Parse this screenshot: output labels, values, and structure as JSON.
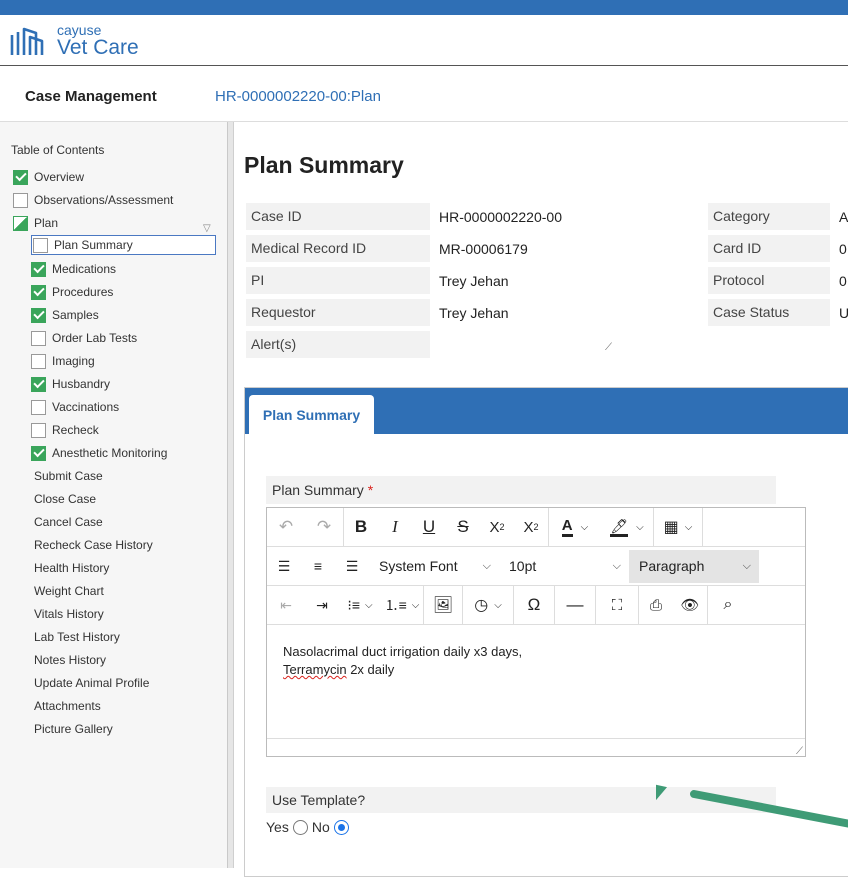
{
  "brand": {
    "small": "cayuse",
    "big": "Vet Care"
  },
  "header": {
    "title": "Case Management",
    "case": "HR-0000002220-00:Plan"
  },
  "toc": {
    "title": "Table of Contents",
    "items": [
      {
        "label": "Overview",
        "state": "checked"
      },
      {
        "label": "Observations/Assessment",
        "state": "empty"
      },
      {
        "label": "Plan",
        "state": "half"
      },
      {
        "label": "Plan Summary",
        "state": "empty",
        "selected": true
      },
      {
        "label": "Medications",
        "state": "checked"
      },
      {
        "label": "Procedures",
        "state": "checked"
      },
      {
        "label": "Samples",
        "state": "checked"
      },
      {
        "label": "Order Lab Tests",
        "state": "empty"
      },
      {
        "label": "Imaging",
        "state": "empty"
      },
      {
        "label": "Husbandry",
        "state": "checked"
      },
      {
        "label": "Vaccinations",
        "state": "empty"
      },
      {
        "label": "Recheck",
        "state": "empty"
      },
      {
        "label": "Anesthetic Monitoring",
        "state": "checked"
      },
      {
        "label": "Submit Case"
      },
      {
        "label": "Close Case"
      },
      {
        "label": "Cancel Case"
      },
      {
        "label": "Recheck Case History"
      },
      {
        "label": "Health History"
      },
      {
        "label": "Weight Chart"
      },
      {
        "label": "Vitals History"
      },
      {
        "label": "Lab Test History"
      },
      {
        "label": "Notes History"
      },
      {
        "label": "Update Animal Profile"
      },
      {
        "label": "Attachments"
      },
      {
        "label": "Picture Gallery"
      }
    ]
  },
  "page_title": "Plan Summary",
  "fields": {
    "case_id": {
      "label": "Case ID",
      "value": "HR-0000002220-00"
    },
    "medical_record_id": {
      "label": "Medical Record ID",
      "value": "MR-00006179"
    },
    "pi": {
      "label": "PI",
      "value": "Trey Jehan"
    },
    "requestor": {
      "label": "Requestor",
      "value": "Trey Jehan"
    },
    "alerts": {
      "label": "Alert(s)",
      "value": ""
    },
    "category": {
      "label": "Category",
      "value": "A"
    },
    "card_id": {
      "label": "Card ID",
      "value": "0"
    },
    "protocol": {
      "label": "Protocol",
      "value": "0"
    },
    "case_status": {
      "label": "Case Status",
      "value": "U"
    }
  },
  "panel": {
    "tab": "Plan Summary"
  },
  "editor": {
    "label": "Plan Summary",
    "required_mark": "*",
    "font_family": "System Font",
    "font_size": "10pt",
    "block_format": "Paragraph",
    "line1": "Nasolacrimal duct irrigation daily x3 days,",
    "line2_word": "Terramycin",
    "line2_rest": " 2x daily"
  },
  "template": {
    "label": "Use Template?",
    "yes": "Yes",
    "no": "No",
    "selected": "No"
  },
  "colors": {
    "brand_blue": "#2f6fb5",
    "check_green": "#3aa55b",
    "arrow_green": "#3f9b76",
    "required_red": "#d9221c"
  }
}
